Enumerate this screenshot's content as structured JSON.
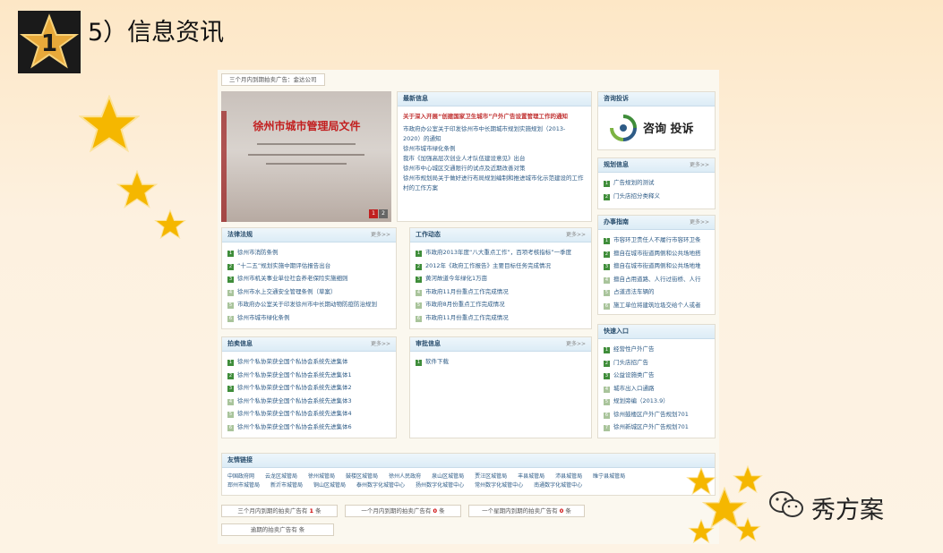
{
  "slide": {
    "title": "5）信息资讯",
    "badge_number": "1",
    "watermark": "秀方案"
  },
  "site": {
    "top_notice": "三个月内到期拍卖广告：金达公司",
    "photo": {
      "doc_title": "徐州市城市管理局文件",
      "pager": [
        "1",
        "2"
      ]
    },
    "latest": {
      "title": "最新信息",
      "headline": "关于深入开展“创建国家卫生城市”户外广告设置管理工作的通知",
      "items": [
        "市政府办公室关于印发徐州市中长期城市规划实施规划（2013-",
        "2020）的通知",
        "徐州市城市绿化条例",
        "我市《加强高层次创业人才队伍建设意见》出台",
        "徐州市中心城区交通限行的试点及近期改善对策",
        "徐州市规划局关于做好进行布局规划编制和推进城市化示范建设的工作",
        "村的工作方案"
      ]
    },
    "consult": {
      "title": "咨询投诉",
      "label": "咨询 投诉"
    },
    "planning": {
      "title": "规划信息",
      "more": "更多>>",
      "items": [
        "广告规划的测试",
        "门头店招分类释义"
      ]
    },
    "laws": {
      "title": "法律法规",
      "more": "更多>>",
      "items": [
        "徐州市消防条例",
        "“十二五”规划实施中期评估报告出台",
        "徐州市机关事业单位社会养老保险实施细则",
        "徐州市水上交通安全管理条例（草案）",
        "市政府办公室关于印发徐州市中长期动物防疫防治规划",
        "徐州市城市绿化条例"
      ]
    },
    "work": {
      "title": "工作动态",
      "more": "更多>>",
      "items": [
        "市政府2013年度“八大重点工作”，百项考核指标”一季度",
        "2012年《政府工作报告》主要目标任务完成情况",
        "黄河故道今年绿化1万亩",
        "市政府11月份重点工作完成情况",
        "市政府8月份重点工作完成情况",
        "市政府11月份重点工作完成情况"
      ]
    },
    "affairs": {
      "title": "办事指南",
      "more": "更多>>",
      "items": [
        "市容环卫责任人不履行市容环卫条",
        "擅自在城市街道两侧和公共场地搭",
        "擅自在城市街道两侧和公共场地堆",
        "擅自占用道路、人行过街桥、人行",
        "占道违法车辆的",
        "施工单位将建筑垃圾交给个人或者"
      ]
    },
    "auction": {
      "title": "拍卖信息",
      "more": "更多>>",
      "items": [
        "徐州个私协荣获全国个私协会系统先进集体",
        "徐州个私协荣获全国个私协会系统先进集体1",
        "徐州个私协荣获全国个私协会系统先进集体2",
        "徐州个私协荣获全国个私协会系统先进集体3",
        "徐州个私协荣获全国个私协会系统先进集体4",
        "徐州个私协荣获全国个私协会系统先进集体6"
      ]
    },
    "review": {
      "title": "审批信息",
      "more": "更多>>",
      "items": [
        "软件下载"
      ]
    },
    "quick": {
      "title": "快速入口",
      "items": [
        "经营性户外广告",
        "门头店招广告",
        "公益设施类广告",
        "城市出入口通路",
        "规划旁编（2013.9）",
        "徐州鼓楼区户外广告规划701",
        "徐州新城区户外广告规划701"
      ]
    },
    "links": {
      "title": "友情链接",
      "row1": [
        "中国政府网",
        "云龙区城管局",
        "徐州城管局",
        "鼓楼区城管局",
        "徐州人民政府",
        "泉山区城管局",
        "贾汪区城管局",
        "丰县城管局",
        "沛县城管局",
        "睢宁县城管局"
      ],
      "row2": [
        "邳州市城管局",
        "新沂市城管局",
        "铜山区城管局",
        "泰州数字化城管中心",
        "扬州数字化城管中心",
        "常州数字化城管中心",
        "南通数字化城管中心"
      ]
    },
    "notices": {
      "three_month_prefix": "三个月内到期的拍卖广告有",
      "three_month_count": "1",
      "one_month_prefix": "一个月内到期的拍卖广告有",
      "one_month_count": "0",
      "one_week_prefix": "一个星期内到期的拍卖广告有",
      "one_week_count": "0",
      "unit": "条",
      "expired": "逾期的拍卖广告有 条"
    }
  },
  "colors": {
    "star": "#f5b700",
    "accent_green": "#3f8d3a",
    "link_blue": "#2d5b86",
    "headline_red": "#c03030"
  }
}
